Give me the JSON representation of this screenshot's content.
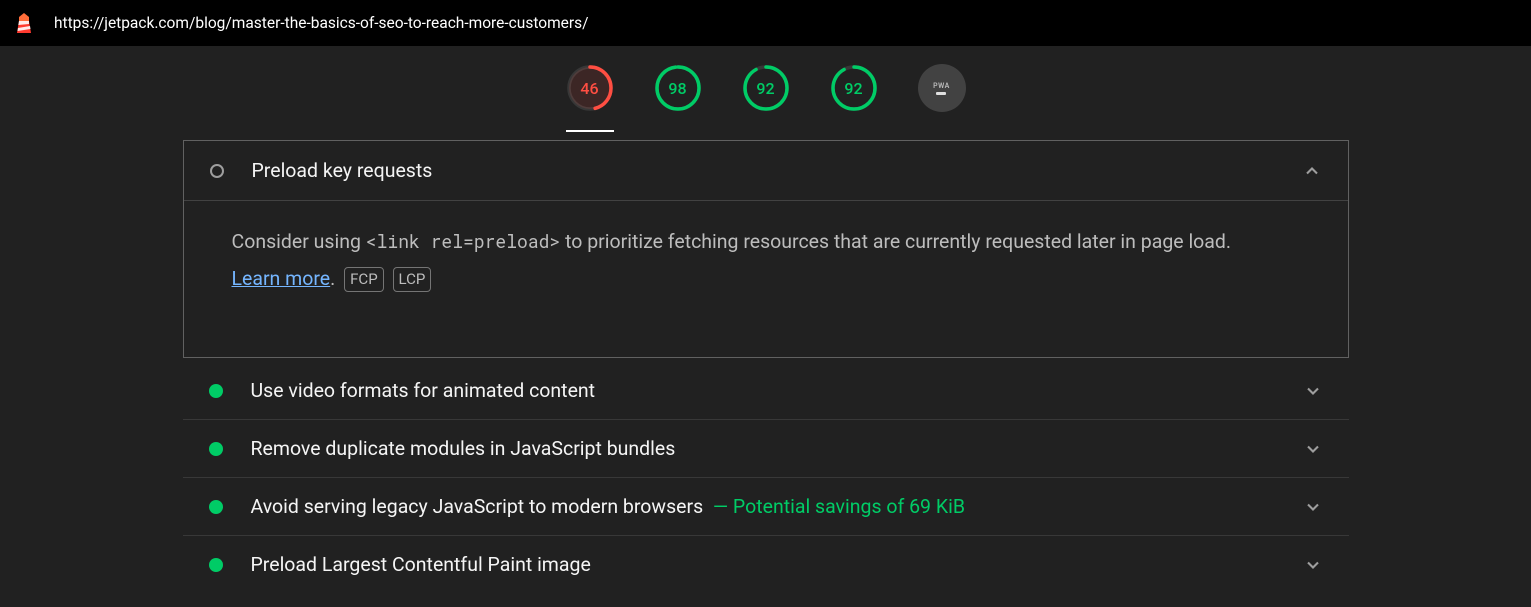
{
  "header": {
    "url": "https://jetpack.com/blog/master-the-basics-of-seo-to-reach-more-customers/"
  },
  "scores": [
    {
      "value": 46,
      "color": "red",
      "pct": 46
    },
    {
      "value": 98,
      "color": "green",
      "pct": 98
    },
    {
      "value": 92,
      "color": "green",
      "pct": 92
    },
    {
      "value": 92,
      "color": "green",
      "pct": 92
    }
  ],
  "pwa_label": "PWA",
  "expanded_audit": {
    "title": "Preload key requests",
    "desc_pre": "Consider using ",
    "desc_code": "<link rel=preload>",
    "desc_post": " to prioritize fetching resources that are currently requested later in page load. ",
    "learn_more": "Learn more",
    "period": ". ",
    "tags": [
      "FCP",
      "LCP"
    ]
  },
  "audits": [
    {
      "title": "Use video formats for animated content",
      "savings": ""
    },
    {
      "title": "Remove duplicate modules in JavaScript bundles",
      "savings": ""
    },
    {
      "title": "Avoid serving legacy JavaScript to modern browsers",
      "savings": "Potential savings of 69 KiB"
    },
    {
      "title": "Preload Largest Contentful Paint image",
      "savings": ""
    }
  ]
}
